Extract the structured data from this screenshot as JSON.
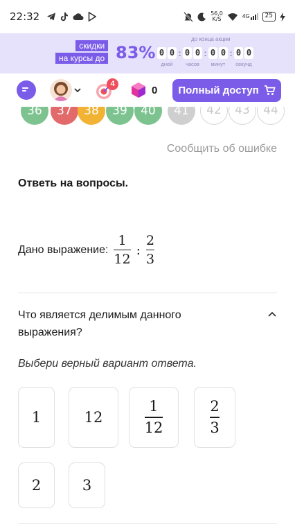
{
  "status_bar": {
    "time": "22:32",
    "net_speed": "56,0",
    "net_speed_unit": "K/S",
    "network": "4G",
    "battery": "25"
  },
  "promo": {
    "badge_line1": "скидки",
    "badge_line2": "на курсы до",
    "percent": "83%",
    "caption": "до конца акции",
    "timer": [
      {
        "digits": [
          "0",
          "0"
        ],
        "unit": "дней"
      },
      {
        "digits": [
          "0",
          "0"
        ],
        "unit": "часов"
      },
      {
        "digits": [
          "0",
          "0"
        ],
        "unit": "минут"
      },
      {
        "digits": [
          "0",
          "0"
        ],
        "unit": "секунд"
      }
    ],
    "accent_color": "#7b5ce8"
  },
  "header": {
    "chat_icon": "chat-icon",
    "avatar_icon": "avatar",
    "target_badge": "4",
    "gems_count": "0",
    "access_button": "Полный доступ"
  },
  "task_numbers": [
    {
      "n": "36",
      "color": "#7cc38f"
    },
    {
      "n": "37",
      "color": "#e26a6a"
    },
    {
      "n": "38",
      "color": "#f2b233"
    },
    {
      "n": "39",
      "color": "#7cc38f"
    },
    {
      "n": "40",
      "color": "#7cc38f"
    },
    {
      "n": "41",
      "color": "#cfcfcf"
    },
    {
      "n": "42",
      "color": "outline"
    },
    {
      "n": "43",
      "color": "outline"
    },
    {
      "n": "44",
      "color": "outline"
    }
  ],
  "report_link": "Сообщить об ошибке",
  "task": {
    "title": "Ответь на вопросы.",
    "expression_label": "Дано выражение:",
    "expression": {
      "left": {
        "num": "1",
        "den": "12"
      },
      "operator": ":",
      "right": {
        "num": "2",
        "den": "3"
      }
    },
    "question": "Что является делимым данного выражения?",
    "hint": "Выбери верный вариант ответа.",
    "options": [
      {
        "text": "1"
      },
      {
        "text": "12"
      },
      {
        "num": "1",
        "den": "12"
      },
      {
        "num": "2",
        "den": "3"
      },
      {
        "text": "2"
      },
      {
        "text": "3"
      }
    ]
  }
}
